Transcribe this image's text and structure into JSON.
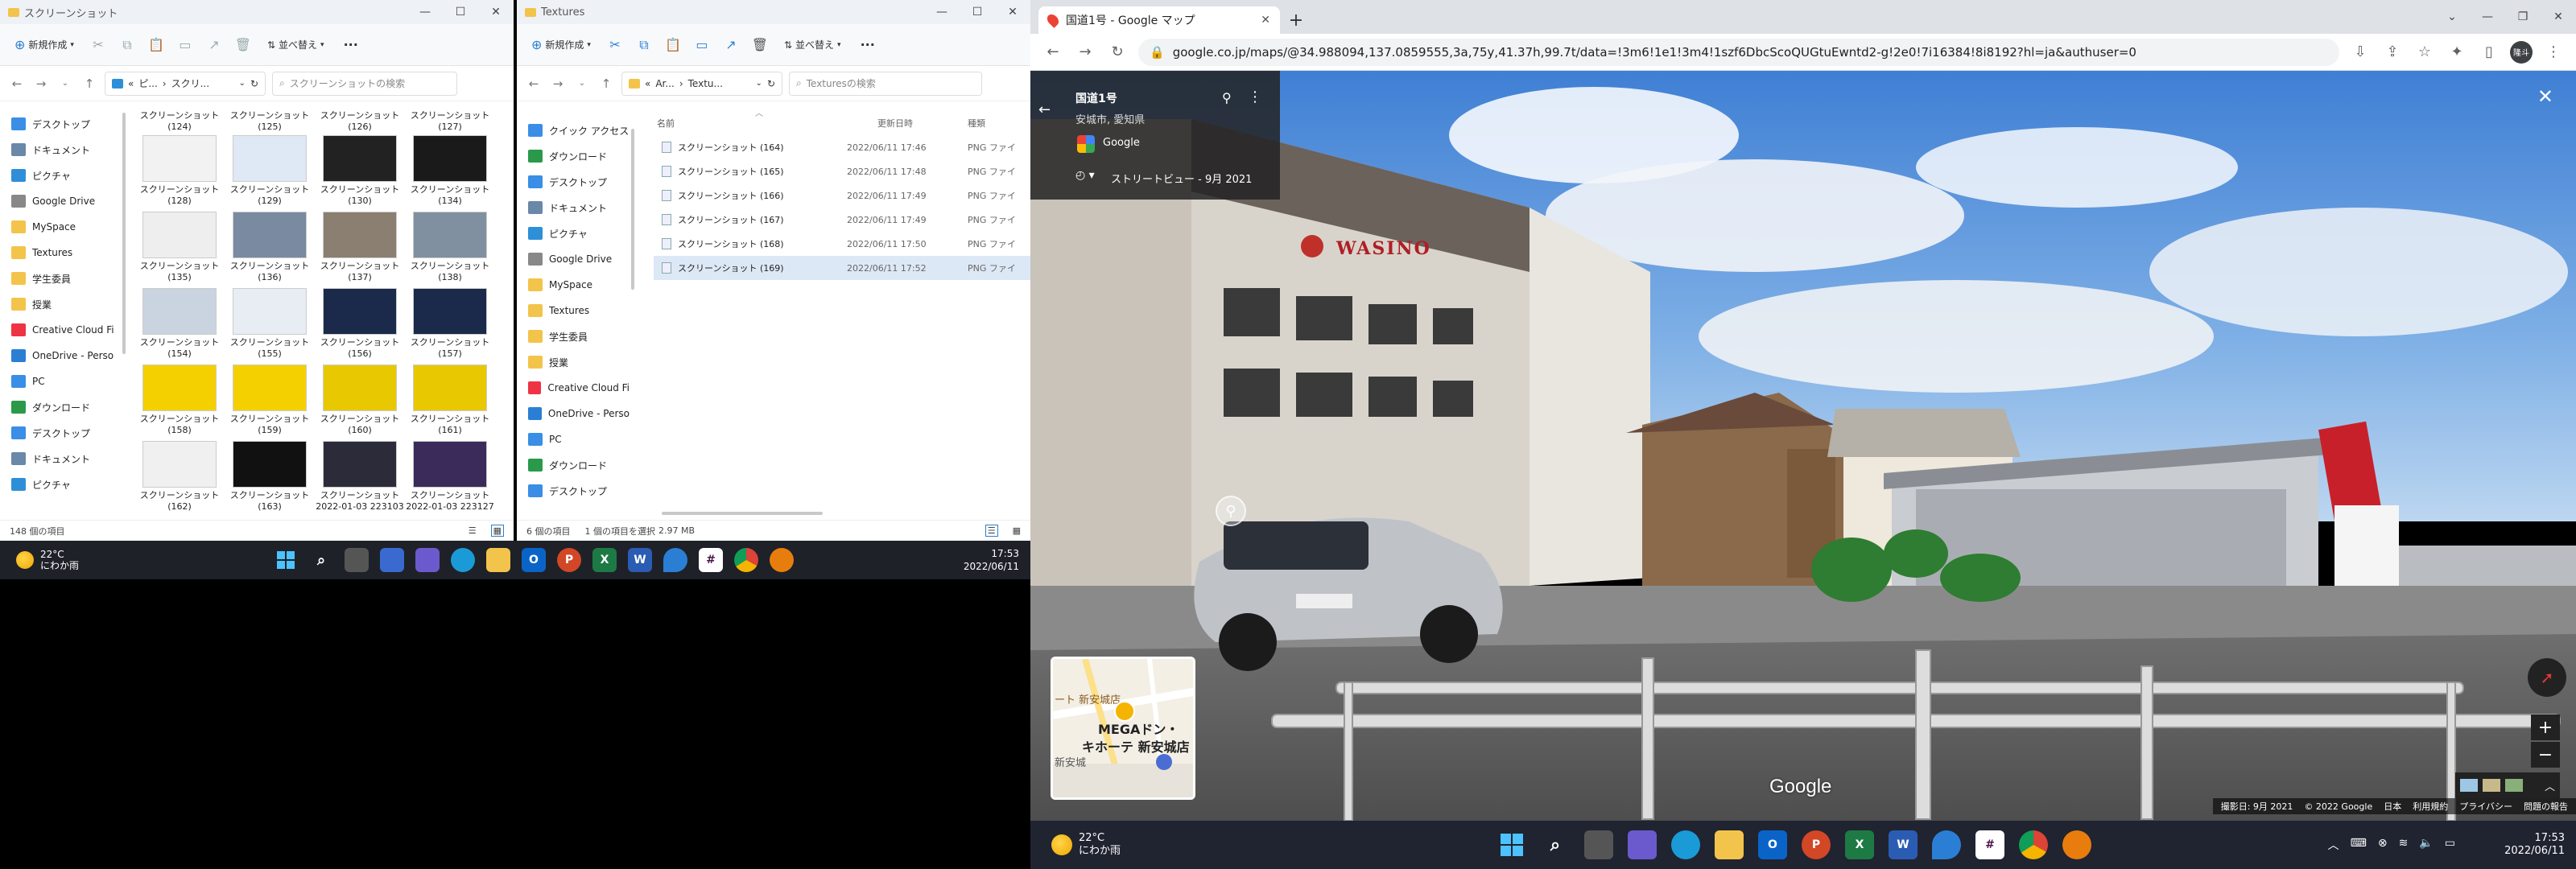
{
  "explorer1": {
    "title": "スクリーンショット",
    "toolbar": {
      "new": "新規作成",
      "sort": "並べ替え",
      "more": "···"
    },
    "path": [
      "ピ...",
      "スクリ..."
    ],
    "search_placeholder": "スクリーンショットの検索",
    "nav": [
      {
        "label": "デスクトップ",
        "color": "#3a8ee6"
      },
      {
        "label": "ドキュメント",
        "color": "#6a88a8"
      },
      {
        "label": "ピクチャ",
        "color": "#2e8fd8"
      },
      {
        "label": "Google Drive",
        "color": "#888"
      },
      {
        "label": "MySpace",
        "color": "#f3c44b"
      },
      {
        "label": "Textures",
        "color": "#f3c44b"
      },
      {
        "label": "学生委員",
        "color": "#f3c44b"
      },
      {
        "label": "授業",
        "color": "#f3c44b"
      },
      {
        "label": "Creative Cloud Fi",
        "color": "#e34"
      },
      {
        "label": "OneDrive - Perso",
        "color": "#2a7fd4"
      },
      {
        "label": "PC",
        "color": "#3a8ee6"
      },
      {
        "label": "ダウンロード",
        "color": "#2a9a4a"
      },
      {
        "label": "デスクトップ",
        "color": "#3a8ee6"
      },
      {
        "label": "ドキュメント",
        "color": "#6a88a8"
      },
      {
        "label": "ピクチャ",
        "color": "#2e8fd8"
      }
    ],
    "thumbs_top_caps": [
      "スクリーンショット\n(124)",
      "スクリーンショット\n(125)",
      "スクリーンショット\n(126)",
      "スクリーンショット\n(127)"
    ],
    "thumbs": [
      {
        "cap1": "スクリーンショット",
        "cap2": "(128)",
        "tone": "#f2f2f2"
      },
      {
        "cap1": "スクリーンショット",
        "cap2": "(129)",
        "tone": "#dfe8f5"
      },
      {
        "cap1": "スクリーンショット",
        "cap2": "(130)",
        "tone": "#222"
      },
      {
        "cap1": "スクリーンショット",
        "cap2": "(134)",
        "tone": "#1a1a1a"
      },
      {
        "cap1": "スクリーンショット",
        "cap2": "(135)",
        "tone": "#eee"
      },
      {
        "cap1": "スクリーンショット",
        "cap2": "(136)",
        "tone": "#7a8aa0"
      },
      {
        "cap1": "スクリーンショット",
        "cap2": "(137)",
        "tone": "#8a7f70"
      },
      {
        "cap1": "スクリーンショット",
        "cap2": "(138)",
        "tone": "#8090a0"
      },
      {
        "cap1": "スクリーンショット",
        "cap2": "(154)",
        "tone": "#c9d4e0"
      },
      {
        "cap1": "スクリーンショット",
        "cap2": "(155)",
        "tone": "#e8edf4"
      },
      {
        "cap1": "スクリーンショット",
        "cap2": "(156)",
        "tone": "#1b2a4a"
      },
      {
        "cap1": "スクリーンショット",
        "cap2": "(157)",
        "tone": "#1b2a4a"
      },
      {
        "cap1": "スクリーンショット",
        "cap2": "(158)",
        "tone": "#f5d000"
      },
      {
        "cap1": "スクリーンショット",
        "cap2": "(159)",
        "tone": "#f5d000"
      },
      {
        "cap1": "スクリーンショット",
        "cap2": "(160)",
        "tone": "#e8c800"
      },
      {
        "cap1": "スクリーンショット",
        "cap2": "(161)",
        "tone": "#e8c800"
      },
      {
        "cap1": "スクリーンショット",
        "cap2": "(162)",
        "tone": "#f0f0f0"
      },
      {
        "cap1": "スクリーンショット",
        "cap2": "(163)",
        "tone": "#111"
      },
      {
        "cap1": "スクリーンショット",
        "cap2": "2022-01-03 223103",
        "tone": "#2b2b3a"
      },
      {
        "cap1": "スクリーンショット",
        "cap2": "2022-01-03 223127",
        "tone": "#3a2b5a"
      }
    ],
    "status": "148 個の項目"
  },
  "explorer2": {
    "title": "Textures",
    "toolbar": {
      "new": "新規作成",
      "sort": "並べ替え",
      "more": "···"
    },
    "path": [
      "Ar...",
      "Textu..."
    ],
    "search_placeholder": "Texturesの検索",
    "nav": [
      {
        "label": "クイック アクセス",
        "color": "#3a8ee6"
      },
      {
        "label": "ダウンロード",
        "color": "#2a9a4a"
      },
      {
        "label": "デスクトップ",
        "color": "#3a8ee6"
      },
      {
        "label": "ドキュメント",
        "color": "#6a88a8"
      },
      {
        "label": "ピクチャ",
        "color": "#2e8fd8"
      },
      {
        "label": "Google Drive",
        "color": "#888"
      },
      {
        "label": "MySpace",
        "color": "#f3c44b"
      },
      {
        "label": "Textures",
        "color": "#f3c44b"
      },
      {
        "label": "学生委員",
        "color": "#f3c44b"
      },
      {
        "label": "授業",
        "color": "#f3c44b"
      },
      {
        "label": "Creative Cloud Fi",
        "color": "#e34"
      },
      {
        "label": "OneDrive - Perso",
        "color": "#2a7fd4"
      },
      {
        "label": "PC",
        "color": "#3a8ee6"
      },
      {
        "label": "ダウンロード",
        "color": "#2a9a4a"
      },
      {
        "label": "デスクトップ",
        "color": "#3a8ee6"
      }
    ],
    "columns": {
      "name": "名前",
      "date": "更新日時",
      "type": "種類"
    },
    "files": [
      {
        "name": "スクリーンショット (164)",
        "date": "2022/06/11 17:46",
        "type": "PNG ファイ"
      },
      {
        "name": "スクリーンショット (165)",
        "date": "2022/06/11 17:48",
        "type": "PNG ファイ"
      },
      {
        "name": "スクリーンショット (166)",
        "date": "2022/06/11 17:49",
        "type": "PNG ファイ"
      },
      {
        "name": "スクリーンショット (167)",
        "date": "2022/06/11 17:49",
        "type": "PNG ファイ"
      },
      {
        "name": "スクリーンショット (168)",
        "date": "2022/06/11 17:50",
        "type": "PNG ファイ"
      },
      {
        "name": "スクリーンショット (169)",
        "date": "2022/06/11 17:52",
        "type": "PNG ファイ"
      }
    ],
    "status_count": "6 個の項目",
    "status_sel": "1 個の項目を選択",
    "status_size": "2.97 MB"
  },
  "taskbar_left": {
    "temp": "22°C",
    "weather": "にわか雨",
    "time": "17:53",
    "date": "2022/06/11"
  },
  "chrome": {
    "tab_title": "国道1号 - Google マップ",
    "new_tab": "+",
    "url": "google.co.jp/maps/@34.988094,137.0859555,3a,75y,41.37h,99.7t/data=!3m6!1e1!3m4!1szf6DbcScoQUGtuEwntd2-g!2e0!7i16384!8i8192?hl=ja&authuser=0",
    "profile": "隆斗"
  },
  "streetview": {
    "road": "国道1号",
    "city": "安城市, 愛知県",
    "provider": "Google",
    "date_label": "ストリートビュー - 9月 2021",
    "sign": "WASINO",
    "watermark": "Google",
    "map_labels": [
      "ート 新安城店",
      "MEGAドン・",
      "キホーテ 新安城店",
      "新安城"
    ],
    "footer": [
      "撮影日: 9月 2021",
      "© 2022 Google",
      "日本",
      "利用規約",
      "プライバシー",
      "問題の報告"
    ]
  },
  "taskbar_right": {
    "temp": "22°C",
    "weather": "にわか雨",
    "time": "17:53",
    "date": "2022/06/11"
  }
}
